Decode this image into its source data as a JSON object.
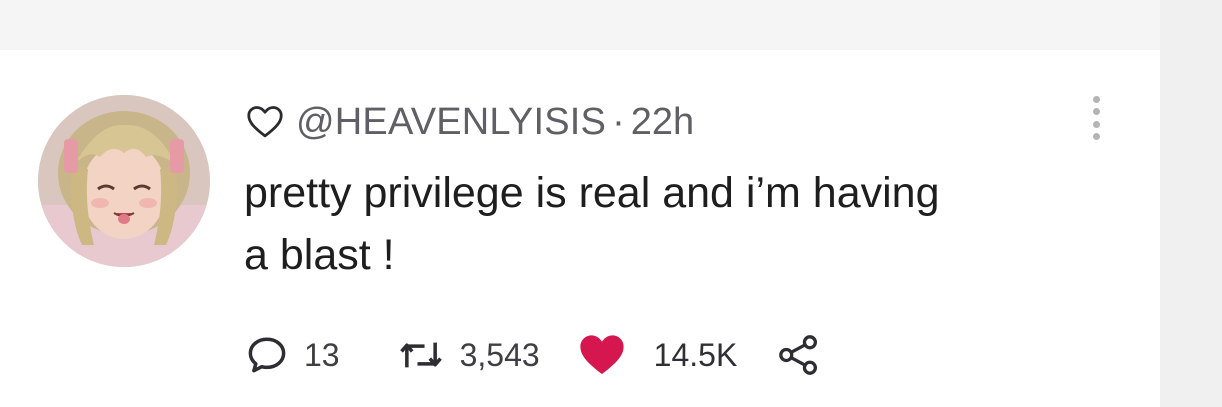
{
  "tweet": {
    "handle": "@HEAVENLYISIS",
    "separator": "·",
    "time": "22h",
    "text": "pretty privilege is real and i’m having\na blast !",
    "avatar_icon": "avatar-anime-girl",
    "follow_icon": "heart-outline-icon",
    "menu_icon": "vertical-dots-icon"
  },
  "stats": {
    "replies": "13",
    "retweets": "3,543",
    "likes": "14.5K",
    "liked": true,
    "like_color": "#d6174f",
    "share_icon": "share-icon"
  },
  "colors": {
    "background": "#f5f5f5",
    "card": "#ffffff",
    "muted_text": "#5f5f66"
  }
}
